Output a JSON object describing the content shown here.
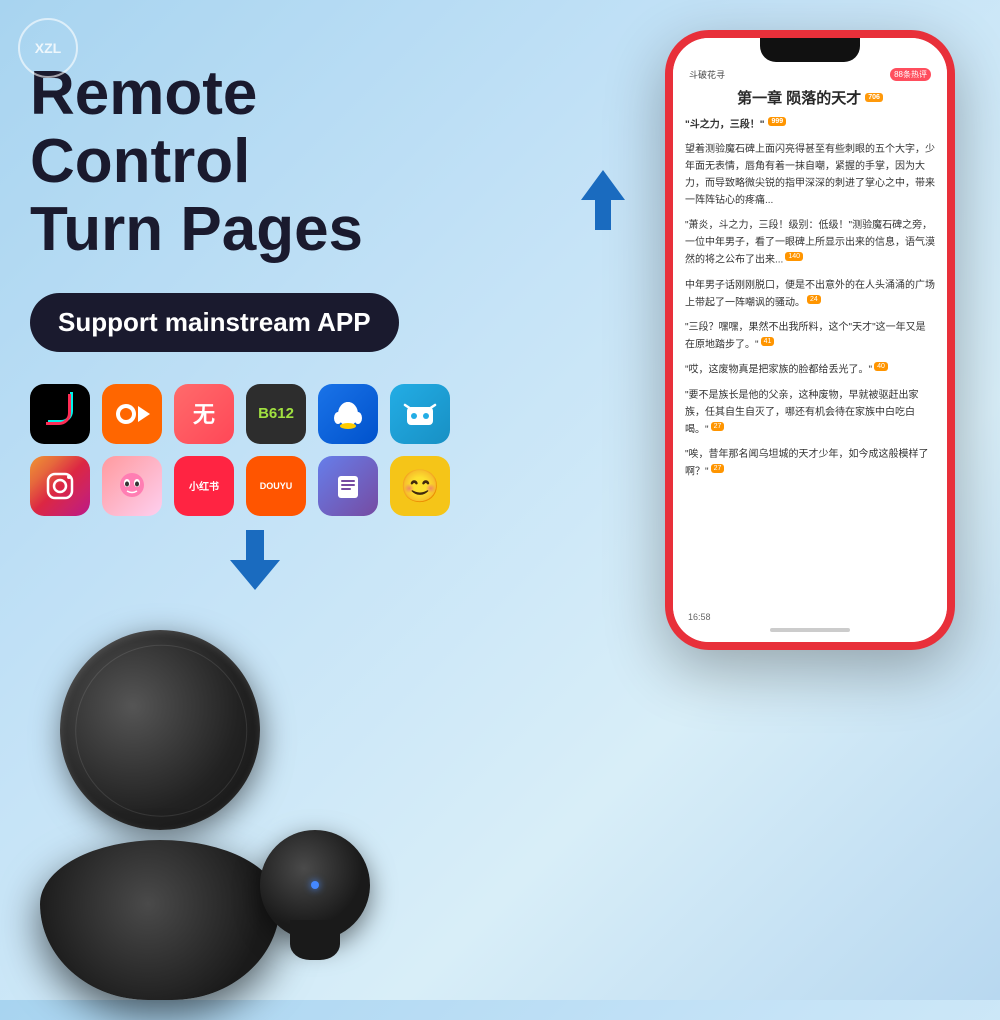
{
  "watermark": {
    "text": "XZL"
  },
  "headline": {
    "line1": "Remote Control",
    "line2": "Turn Pages"
  },
  "badge": {
    "label": "Support mainstream APP"
  },
  "apps": [
    {
      "id": "douyin",
      "name": "抖音",
      "color_class": "icon-douyin"
    },
    {
      "id": "kuaishou",
      "name": "快手",
      "color_class": "icon-kuaishou"
    },
    {
      "id": "wuyu",
      "name": "无鱼",
      "color_class": "icon-wuyu"
    },
    {
      "id": "b612",
      "name": "B612",
      "color_class": "icon-b612"
    },
    {
      "id": "qq",
      "name": "QQ",
      "color_class": "icon-qq"
    },
    {
      "id": "bilibili",
      "name": "B",
      "color_class": "icon-bilibili"
    },
    {
      "id": "insta",
      "name": "",
      "color_class": "icon-insta"
    },
    {
      "id": "anime",
      "name": "",
      "color_class": "icon-anime"
    },
    {
      "id": "xhs",
      "name": "小红书",
      "color_class": "icon-xhs"
    },
    {
      "id": "douyu",
      "name": "DOUYU",
      "color_class": "icon-douyu"
    },
    {
      "id": "reading",
      "name": "📖",
      "color_class": "icon-reading"
    },
    {
      "id": "emoji",
      "name": "😊",
      "color_class": "icon-emoji"
    }
  ],
  "phone": {
    "app_name": "斗破花寻",
    "hot_count": "88条热评",
    "chapter_title": "第一章 陨落的天才",
    "chapter_badge": "706",
    "paragraphs": [
      {
        "text": "\"斗之力，三段！\"",
        "count": "999"
      },
      {
        "text": "望着测验魔石碑上面闪亮得甚至有些刺眼的五个大字，少年面无表情，唇角有着一抹自嘲，紧握的手掌，因为大力，而导致略微尖锐的指甲深深的刺进了掌心之中，带来一阵阵钻心的疼痛...",
        "count": ""
      },
      {
        "text": "\"萧炎，斗之力，三段！级别：低级！\"测验魔石碑之旁，一位中年男子，看了一眼碑上所显示出来的信息，语气漠然的将之公布了出来...",
        "count": "140"
      },
      {
        "text": "中年男子话刚刚脱口，便是不出意外的在人头涌涌的广场上带起了一阵嘲讽的骚动。",
        "count": "24"
      },
      {
        "text": "\"三段？嘿嘿，果然不出我所料，这个\"天才\"这一年又是在原地踏步了。\"",
        "count": "41"
      },
      {
        "text": "\"哎，这废物真是把家族的脸都给丢光了。\"",
        "count": "40"
      },
      {
        "text": "\"要不是族长是他的父亲，这种废物，早就被驱赶出家族，任其自生自灭了，哪还有机会待在家族中白吃白喝。\"",
        "count": "27"
      },
      {
        "text": "\"唉，昔年那名闻乌坦城的天才少年，如今成这般模样了啊？\"",
        "count": "27"
      }
    ],
    "time": "16:58"
  },
  "arrow_up_label": "scroll up",
  "arrow_down_label": "scroll down"
}
